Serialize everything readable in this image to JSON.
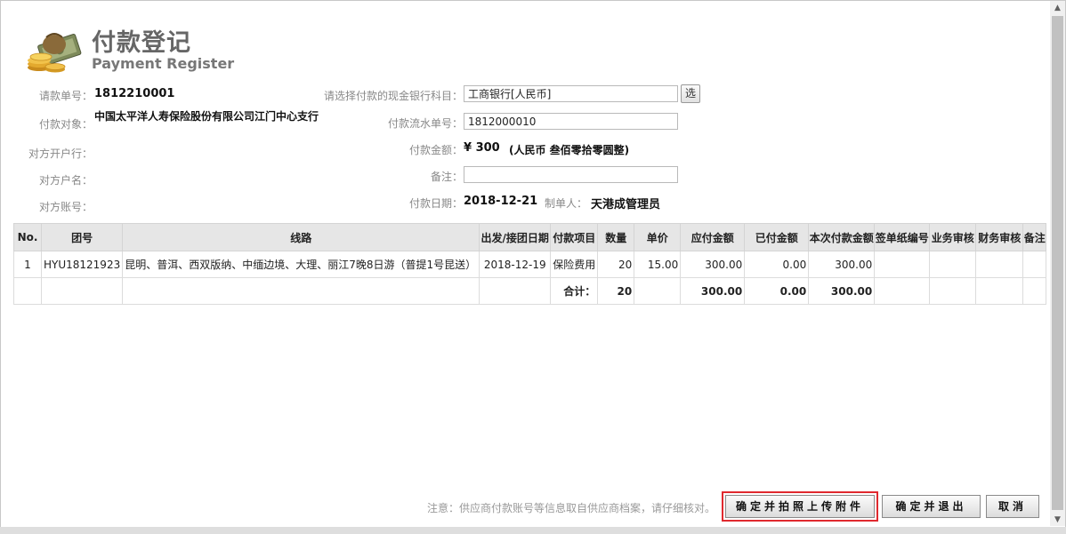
{
  "header": {
    "title_cn": "付款登记",
    "title_en": "Payment Register",
    "logo_icon": "money-bag-coins-icon"
  },
  "form": {
    "request_no_label": "请款单号：",
    "request_no": "1812210001",
    "payee_label": "付款对象：",
    "payee": "中国太平洋人寿保险股份有限公司江门中心支行",
    "bank_label": "对方开户行：",
    "account_name_label": "对方户名：",
    "account_no_label": "对方账号：",
    "cash_account_label": "请选择付款的现金银行科目：",
    "cash_account_value": "工商银行[人民币]",
    "select_button": "选",
    "serial_label": "付款流水单号：",
    "serial_value": "1812000010",
    "amount_label": "付款金额：",
    "amount": "¥ 300",
    "amount_words": "(人民币 叁佰零拾零圆整)",
    "remark_label": "备注：",
    "remark_value": "",
    "date_label": "付款日期：",
    "date": "2018-12-21",
    "maker_label": "制单人：",
    "maker": "天港成管理员"
  },
  "table": {
    "headers": [
      "No.",
      "团号",
      "线路",
      "出发/接团日期",
      "付款项目",
      "数量",
      "单价",
      "应付金额",
      "已付金额",
      "本次付款金额",
      "签单纸编号",
      "业务审核",
      "财务审核",
      "备注"
    ],
    "rows": [
      {
        "no": "1",
        "group": "HYU18121923",
        "route": "昆明、普洱、西双版纳、中缅边境、大理、丽江7晚8日游（普提1号昆送）",
        "date": "2018-12-19",
        "item": "保险费用",
        "qty": "20",
        "price": "15.00",
        "payable": "300.00",
        "paid": "0.00",
        "current": "300.00",
        "sign_no": "",
        "biz_audit": "",
        "fin_audit": "",
        "remark": ""
      }
    ],
    "total": {
      "label": "合计：",
      "qty": "20",
      "payable": "300.00",
      "paid": "0.00",
      "current": "300.00"
    }
  },
  "footer": {
    "note": "注意：供应商付款账号等信息取自供应商档案，请仔细核对。",
    "confirm_upload": "确定并拍照上传附件",
    "confirm_exit": "确定并退出",
    "cancel": "取消"
  },
  "colors": {
    "highlight": "#e0292f",
    "header_bg": "#e6e6e6"
  }
}
